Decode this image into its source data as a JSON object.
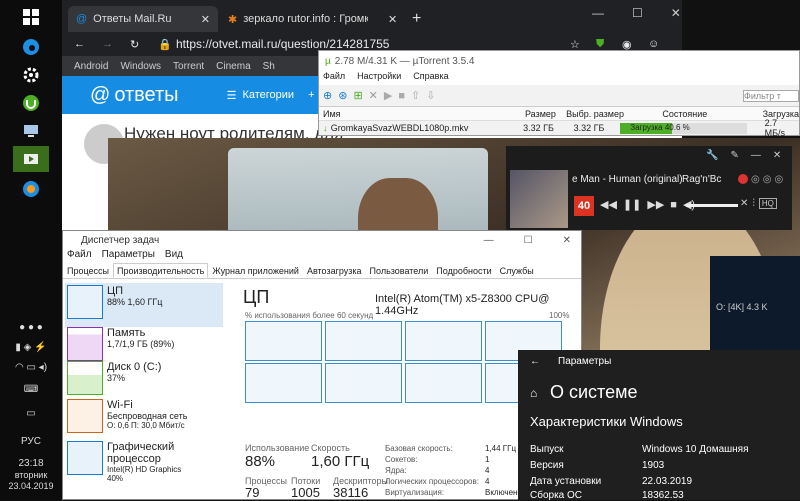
{
  "taskbar": {
    "icons": [
      "windows-icon",
      "edge-icon",
      "gear-icon",
      "utorrent-icon",
      "pc-icon",
      "video-icon",
      "cpu-icon"
    ],
    "lang": "РУС",
    "time": "23:18",
    "weekday": "вторник",
    "date": "23.04.2019"
  },
  "browser": {
    "tabs": [
      {
        "label": "Ответы Mail.Ru"
      },
      {
        "label": "зеркало rutor.info : Громкая св"
      }
    ],
    "new_tab": "+",
    "url": "https://otvet.mail.ru/question/214281755",
    "bookmarks": [
      "Android",
      "Windows",
      "Torrent",
      "Cinema",
      "Sh"
    ],
    "site": {
      "logo": "ответы",
      "categories": "Категории",
      "ask": "+ Спр",
      "question": "Нужен ноут родителям, для"
    }
  },
  "utorrent": {
    "title": "2.78 M/4.31 K — µTorrent 3.5.4",
    "menu": [
      "Файл",
      "Настройки",
      "Справка"
    ],
    "filter_placeholder": "Фильтр т",
    "columns": [
      "Имя",
      "Размер",
      "Выбр. размер",
      "Состояние",
      "Загрузка"
    ],
    "rows": [
      {
        "name": "GromkayaSvazWEBDL1080p.mkv",
        "size": "3.32 ГБ",
        "sel_size": "3.32 ГБ",
        "state": "Загрузка 40.6 %",
        "progress": 40.6,
        "speed": "2.7 МБ/s"
      }
    ],
    "status_right": "О: [4K] 4.3 K"
  },
  "player": {
    "track": "e Man - Human (original)",
    "genre": "Rag'n'Bc",
    "badge": "40",
    "hq": "HQ"
  },
  "taskmgr": {
    "title": "Диспетчер задач",
    "menu": [
      "Файл",
      "Параметры",
      "Вид"
    ],
    "tabs": [
      "Процессы",
      "Производительность",
      "Журнал приложений",
      "Автозагрузка",
      "Пользователи",
      "Подробности",
      "Службы"
    ],
    "active_tab": 1,
    "side": [
      {
        "name": "ЦП",
        "sub": "88% 1,60 ГГц",
        "color": "#1a7cd1"
      },
      {
        "name": "Память",
        "sub": "1,7/1,9 ГБ (89%)",
        "color": "#8b2fb5"
      },
      {
        "name": "Диск 0 (C:)",
        "sub": "37%",
        "color": "#4caf26"
      },
      {
        "name": "Wi-Fi",
        "sub": "Беспроводная сеть",
        "sub2": "О: 0,6 П: 30,0 Мбит/с",
        "color": "#c5661a"
      },
      {
        "name": "Графический процессор",
        "sub": "Intel(R) HD Graphics",
        "sub2": "40%",
        "color": "#1a7cd1"
      }
    ],
    "cpu": {
      "heading": "ЦП",
      "model": "Intel(R) Atom(TM) x5-Z8300 CPU@ 1.44GHz",
      "graph_label": "% использования более 60 секунд",
      "graph_max": "100%",
      "usage_label": "Использование",
      "usage": "88%",
      "speed_label": "Скорость",
      "speed": "1,60 ГГц",
      "proc_label": "Процессы",
      "proc": "79",
      "threads_label": "Потоки",
      "threads": "1005",
      "handles_label": "Дескрипторы",
      "handles": "38116",
      "details": [
        {
          "k": "Базовая скорость:",
          "v": "1,44 ГГц"
        },
        {
          "k": "Сокетов:",
          "v": "1"
        },
        {
          "k": "Ядра:",
          "v": "4"
        },
        {
          "k": "Логических процессоров:",
          "v": "4"
        },
        {
          "k": "Виртуализация:",
          "v": "Включено"
        }
      ]
    }
  },
  "settings": {
    "title": "Параметры",
    "heading": "О системе",
    "section": "Характеристики Windows",
    "rows": [
      {
        "k": "Выпуск",
        "v": "Windows 10 Домашняя"
      },
      {
        "k": "Версия",
        "v": "1903"
      },
      {
        "k": "Дата установки",
        "v": "22.03.2019"
      },
      {
        "k": "Сборка ОС",
        "v": "18362.53"
      }
    ]
  }
}
